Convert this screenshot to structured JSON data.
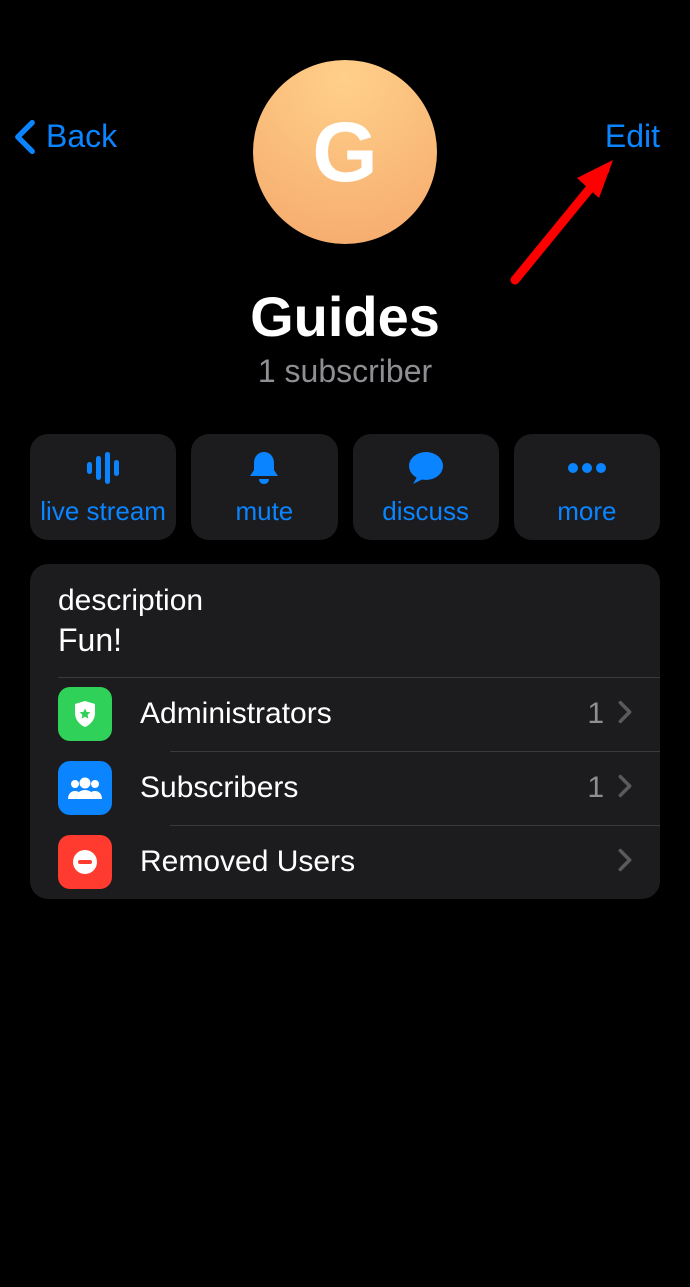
{
  "nav": {
    "back_label": "Back",
    "edit_label": "Edit"
  },
  "profile": {
    "avatar_letter": "G",
    "title": "Guides",
    "subtitle": "1 subscriber"
  },
  "actions": {
    "live_stream": "live stream",
    "mute": "mute",
    "discuss": "discuss",
    "more": "more"
  },
  "description": {
    "label": "description",
    "value": "Fun!"
  },
  "rows": {
    "administrators": {
      "label": "Administrators",
      "count": "1"
    },
    "subscribers": {
      "label": "Subscribers",
      "count": "1"
    },
    "removed_users": {
      "label": "Removed Users"
    }
  }
}
